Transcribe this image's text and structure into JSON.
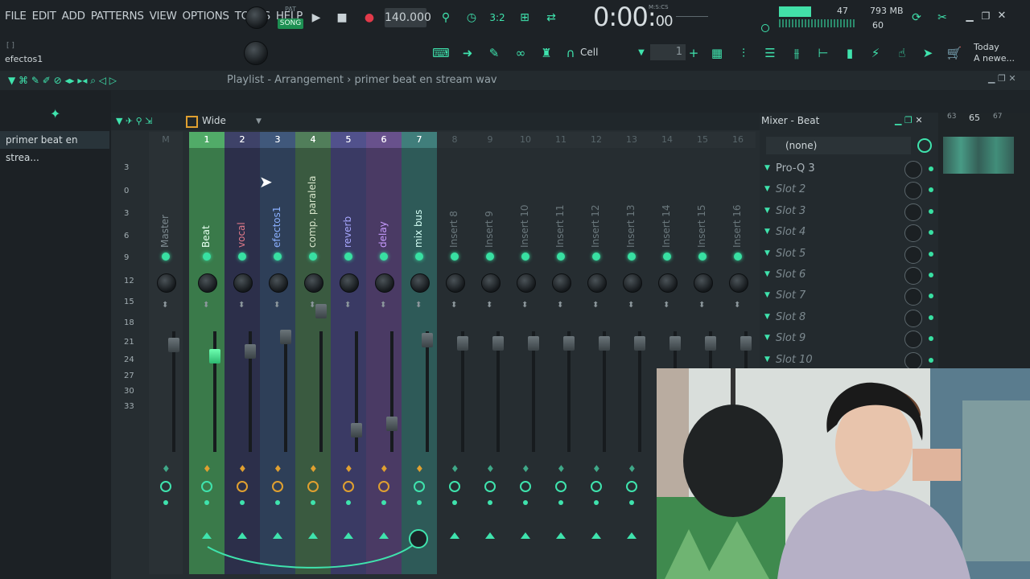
{
  "menu": [
    "FILE",
    "EDIT",
    "ADD",
    "PATTERNS",
    "VIEW",
    "OPTIONS",
    "TOOLS",
    "HELP"
  ],
  "transport": {
    "mode_pat": "PAT",
    "mode_song": "SONG",
    "tempo": "140.000",
    "time": "0:00:",
    "time_small": "00",
    "time_label": "M:S:CS"
  },
  "stats": {
    "cpu": "47",
    "memory": "793 MB",
    "polyphony": "60"
  },
  "hint": {
    "top": "[ ]",
    "text": "efectos1"
  },
  "toolbar2": {
    "snap": "Cell",
    "pattern_num": "1",
    "news_line1": "Today",
    "news_line2": "A newe..."
  },
  "playlist": {
    "title": "Playlist - Arrangement",
    "breadcrumb": "primer beat en stream wav",
    "browser_item": "primer beat en strea..."
  },
  "mixer": {
    "width_mode": "Wide",
    "title": "Mixer - Beat",
    "preset": "(none)",
    "scale": [
      "3",
      "0",
      "3",
      "6",
      "9",
      "12",
      "15",
      "18",
      "21",
      "24",
      "27",
      "30",
      "33"
    ],
    "tracks": [
      {
        "num": "M",
        "name": "Master",
        "color": "#2a3135",
        "text": "#7d8a90"
      },
      {
        "num": "1",
        "name": "Beat",
        "color": "#3a7a4a",
        "text": "#e6fff0"
      },
      {
        "num": "2",
        "name": "vocal",
        "color": "#2c2f4a",
        "text": "#e07a8a"
      },
      {
        "num": "3",
        "name": "efectos1",
        "color": "#2e3f58",
        "text": "#8ab0ff"
      },
      {
        "num": "4",
        "name": "comp. paralela",
        "color": "#3a5a40",
        "text": "#d8e6cc"
      },
      {
        "num": "5",
        "name": "reverb",
        "color": "#3a3a64",
        "text": "#a8a8ff"
      },
      {
        "num": "6",
        "name": "delay",
        "color": "#4a3a64",
        "text": "#c89cff"
      },
      {
        "num": "7",
        "name": "mix bus",
        "color": "#2e5a58",
        "text": "#d4fff6"
      },
      {
        "num": "8",
        "name": "Insert 8",
        "color": "#262d31",
        "text": "#6a777c"
      },
      {
        "num": "9",
        "name": "Insert 9",
        "color": "#262d31",
        "text": "#6a777c"
      },
      {
        "num": "10",
        "name": "Insert 10",
        "color": "#262d31",
        "text": "#6a777c"
      },
      {
        "num": "11",
        "name": "Insert 11",
        "color": "#262d31",
        "text": "#6a777c"
      },
      {
        "num": "12",
        "name": "Insert 12",
        "color": "#262d31",
        "text": "#6a777c"
      },
      {
        "num": "13",
        "name": "Insert 13",
        "color": "#262d31",
        "text": "#6a777c"
      },
      {
        "num": "14",
        "name": "Insert 14",
        "color": "#262d31",
        "text": "#6a777c"
      },
      {
        "num": "15",
        "name": "Insert 15",
        "color": "#262d31",
        "text": "#6a777c"
      },
      {
        "num": "16",
        "name": "Insert 16",
        "color": "#262d31",
        "text": "#6a777c"
      }
    ],
    "slots": [
      "Pro-Q 3",
      "Slot 2",
      "Slot 3",
      "Slot 4",
      "Slot 5",
      "Slot 6",
      "Slot 7",
      "Slot 8",
      "Slot 9",
      "Slot 10"
    ]
  },
  "timeline": {
    "bars": [
      "63",
      "65",
      "67"
    ]
  },
  "colors": {
    "accent": "#3fe3ad",
    "background": "#1e2428"
  }
}
